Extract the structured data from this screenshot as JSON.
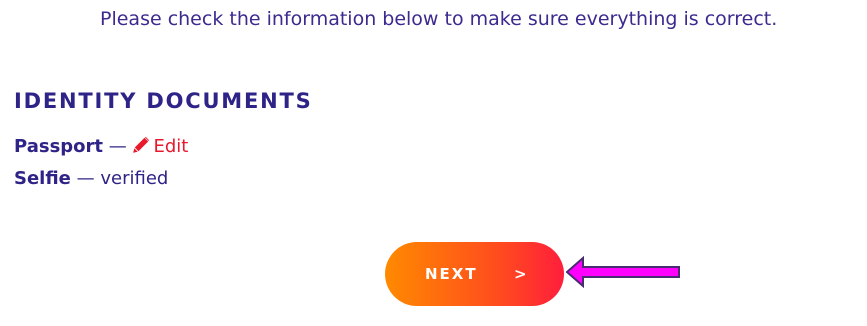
{
  "intro_text": "Please check the information below to make sure everything is correct.",
  "section": {
    "title": "IDENTITY DOCUMENTS"
  },
  "documents": [
    {
      "name": "Passport",
      "separator": "—",
      "action_label": "Edit",
      "action_icon": "pencil-icon"
    },
    {
      "name": "Selfie",
      "separator": "—",
      "status": "verified"
    }
  ],
  "next_button": {
    "label": "NEXT",
    "arrow": ">"
  },
  "colors": {
    "heading": "#2e2387",
    "intro": "#3c2a8f",
    "edit": "#e8192c",
    "button_start": "#ff8a00",
    "button_end": "#ff1e3c",
    "pointer": "#ff00ff"
  }
}
